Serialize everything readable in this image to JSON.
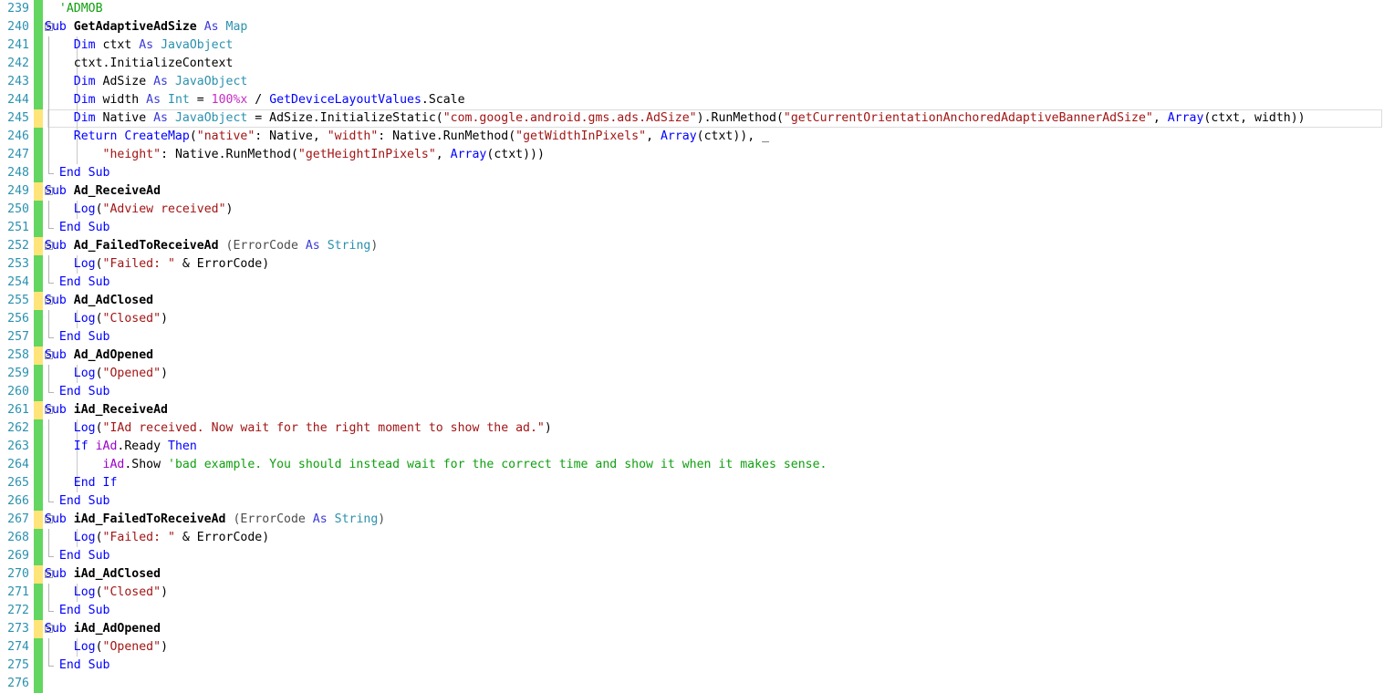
{
  "editor": {
    "app": "B4A Code Editor",
    "language": "Basic4Android",
    "first_visible_line": 239,
    "last_visible_line": 276,
    "current_line": 245,
    "colors": {
      "background": "#ffffff",
      "line_number": "#2b91af",
      "marker_saved": "#62d660",
      "marker_unsaved": "#ffe47a",
      "keyword": "#0000ff",
      "type": "#2b91af",
      "string": "#a31515",
      "comment": "#10a010",
      "number": "#c52bc5",
      "object": "#9b00c8"
    },
    "lines": [
      {
        "n": "239",
        "marker": "green",
        "fold": false,
        "indent": 0,
        "tokens": [
          {
            "t": "  ",
            "c": "punct"
          },
          {
            "t": "'ADMOB",
            "c": "cmt"
          }
        ]
      },
      {
        "n": "240",
        "marker": "green",
        "fold": true,
        "foldstart": true,
        "indent": 0,
        "tokens": [
          {
            "t": "Sub ",
            "c": "kw"
          },
          {
            "t": "GetAdaptiveAdSize",
            "c": "subname"
          },
          {
            "t": " ",
            "c": "punct"
          },
          {
            "t": "As ",
            "c": "as"
          },
          {
            "t": "Map",
            "c": "type"
          }
        ]
      },
      {
        "n": "241",
        "marker": "green",
        "fold": false,
        "indent": 1,
        "tokens": [
          {
            "t": "    ",
            "c": "punct"
          },
          {
            "t": "Dim ",
            "c": "kw"
          },
          {
            "t": "ctxt ",
            "c": "id"
          },
          {
            "t": "As ",
            "c": "as"
          },
          {
            "t": "JavaObject",
            "c": "type"
          }
        ]
      },
      {
        "n": "242",
        "marker": "green",
        "fold": false,
        "indent": 1,
        "tokens": [
          {
            "t": "    ",
            "c": "punct"
          },
          {
            "t": "ctxt.InitializeContext",
            "c": "id"
          }
        ]
      },
      {
        "n": "243",
        "marker": "green",
        "fold": false,
        "indent": 1,
        "tokens": [
          {
            "t": "    ",
            "c": "punct"
          },
          {
            "t": "Dim ",
            "c": "kw"
          },
          {
            "t": "AdSize ",
            "c": "id"
          },
          {
            "t": "As ",
            "c": "as"
          },
          {
            "t": "JavaObject",
            "c": "type"
          }
        ]
      },
      {
        "n": "244",
        "marker": "green",
        "fold": false,
        "indent": 1,
        "tokens": [
          {
            "t": "    ",
            "c": "punct"
          },
          {
            "t": "Dim ",
            "c": "kw"
          },
          {
            "t": "width ",
            "c": "id"
          },
          {
            "t": "As ",
            "c": "as"
          },
          {
            "t": "Int ",
            "c": "type"
          },
          {
            "t": "= ",
            "c": "punct"
          },
          {
            "t": "100%x",
            "c": "num"
          },
          {
            "t": " / ",
            "c": "punct"
          },
          {
            "t": "GetDeviceLayoutValues",
            "c": "fn"
          },
          {
            "t": ".Scale",
            "c": "id"
          }
        ]
      },
      {
        "n": "245",
        "marker": "yellow",
        "fold": false,
        "current": true,
        "indent": 1,
        "tokens": [
          {
            "t": "    ",
            "c": "punct"
          },
          {
            "t": "Dim ",
            "c": "kw"
          },
          {
            "t": "Native ",
            "c": "id"
          },
          {
            "t": "As ",
            "c": "as"
          },
          {
            "t": "JavaObject ",
            "c": "type"
          },
          {
            "t": "= ",
            "c": "punct"
          },
          {
            "t": "AdSize.InitializeStatic(",
            "c": "id"
          },
          {
            "t": "\"com.google.android.gms.ads.AdSize\"",
            "c": "str"
          },
          {
            "t": ").RunMethod(",
            "c": "id"
          },
          {
            "t": "\"getCurrentOrientationAnchoredAdaptiveBannerAdSize\"",
            "c": "str"
          },
          {
            "t": ", ",
            "c": "punct"
          },
          {
            "t": "Array",
            "c": "fn"
          },
          {
            "t": "(ctxt, width))",
            "c": "id"
          }
        ]
      },
      {
        "n": "246",
        "marker": "green",
        "fold": false,
        "indent": 1,
        "tokens": [
          {
            "t": "    ",
            "c": "punct"
          },
          {
            "t": "Return ",
            "c": "kw"
          },
          {
            "t": "CreateMap",
            "c": "fn"
          },
          {
            "t": "(",
            "c": "id"
          },
          {
            "t": "\"native\"",
            "c": "str"
          },
          {
            "t": ": Native, ",
            "c": "id"
          },
          {
            "t": "\"width\"",
            "c": "str"
          },
          {
            "t": ": Native.RunMethod(",
            "c": "id"
          },
          {
            "t": "\"getWidthInPixels\"",
            "c": "str"
          },
          {
            "t": ", ",
            "c": "punct"
          },
          {
            "t": "Array",
            "c": "fn"
          },
          {
            "t": "(ctxt)), _",
            "c": "id"
          }
        ]
      },
      {
        "n": "247",
        "marker": "green",
        "fold": false,
        "indent": 1,
        "tokens": [
          {
            "t": "        ",
            "c": "punct"
          },
          {
            "t": "\"height\"",
            "c": "str"
          },
          {
            "t": ": Native.RunMethod(",
            "c": "id"
          },
          {
            "t": "\"getHeightInPixels\"",
            "c": "str"
          },
          {
            "t": ", ",
            "c": "punct"
          },
          {
            "t": "Array",
            "c": "fn"
          },
          {
            "t": "(ctxt)))",
            "c": "id"
          }
        ]
      },
      {
        "n": "248",
        "marker": "green",
        "fold": false,
        "foldend": true,
        "indent": 0,
        "tokens": [
          {
            "t": "  ",
            "c": "punct"
          },
          {
            "t": "End Sub",
            "c": "kw"
          }
        ]
      },
      {
        "n": "249",
        "marker": "yellow",
        "fold": true,
        "foldstart": true,
        "indent": 0,
        "tokens": [
          {
            "t": "Sub ",
            "c": "kw"
          },
          {
            "t": "Ad_ReceiveAd",
            "c": "subname"
          }
        ]
      },
      {
        "n": "250",
        "marker": "green",
        "fold": false,
        "indent": 1,
        "tokens": [
          {
            "t": "    ",
            "c": "punct"
          },
          {
            "t": "Log",
            "c": "fn"
          },
          {
            "t": "(",
            "c": "id"
          },
          {
            "t": "\"Adview received\"",
            "c": "str"
          },
          {
            "t": ")",
            "c": "id"
          }
        ]
      },
      {
        "n": "251",
        "marker": "green",
        "fold": false,
        "foldend": true,
        "indent": 0,
        "tokens": [
          {
            "t": "  ",
            "c": "punct"
          },
          {
            "t": "End Sub",
            "c": "kw"
          }
        ]
      },
      {
        "n": "252",
        "marker": "yellow",
        "fold": true,
        "foldstart": true,
        "indent": 0,
        "tokens": [
          {
            "t": "Sub ",
            "c": "kw"
          },
          {
            "t": "Ad_FailedToReceiveAd",
            "c": "subname"
          },
          {
            "t": " (",
            "c": "param"
          },
          {
            "t": "ErrorCode ",
            "c": "param"
          },
          {
            "t": "As ",
            "c": "as"
          },
          {
            "t": "String",
            "c": "type"
          },
          {
            "t": ")",
            "c": "param"
          }
        ]
      },
      {
        "n": "253",
        "marker": "green",
        "fold": false,
        "indent": 1,
        "tokens": [
          {
            "t": "    ",
            "c": "punct"
          },
          {
            "t": "Log",
            "c": "fn"
          },
          {
            "t": "(",
            "c": "id"
          },
          {
            "t": "\"Failed: \"",
            "c": "str"
          },
          {
            "t": " & ErrorCode)",
            "c": "id"
          }
        ]
      },
      {
        "n": "254",
        "marker": "green",
        "fold": false,
        "foldend": true,
        "indent": 0,
        "tokens": [
          {
            "t": "  ",
            "c": "punct"
          },
          {
            "t": "End Sub",
            "c": "kw"
          }
        ]
      },
      {
        "n": "255",
        "marker": "yellow",
        "fold": true,
        "foldstart": true,
        "indent": 0,
        "tokens": [
          {
            "t": "Sub ",
            "c": "kw"
          },
          {
            "t": "Ad_AdClosed",
            "c": "subname"
          }
        ]
      },
      {
        "n": "256",
        "marker": "green",
        "fold": false,
        "indent": 1,
        "tokens": [
          {
            "t": "    ",
            "c": "punct"
          },
          {
            "t": "Log",
            "c": "fn"
          },
          {
            "t": "(",
            "c": "id"
          },
          {
            "t": "\"Closed\"",
            "c": "str"
          },
          {
            "t": ")",
            "c": "id"
          }
        ]
      },
      {
        "n": "257",
        "marker": "green",
        "fold": false,
        "foldend": true,
        "indent": 0,
        "tokens": [
          {
            "t": "  ",
            "c": "punct"
          },
          {
            "t": "End Sub",
            "c": "kw"
          }
        ]
      },
      {
        "n": "258",
        "marker": "yellow",
        "fold": true,
        "foldstart": true,
        "indent": 0,
        "tokens": [
          {
            "t": "Sub ",
            "c": "kw"
          },
          {
            "t": "Ad_AdOpened",
            "c": "subname"
          }
        ]
      },
      {
        "n": "259",
        "marker": "green",
        "fold": false,
        "indent": 1,
        "tokens": [
          {
            "t": "    ",
            "c": "punct"
          },
          {
            "t": "Log",
            "c": "fn"
          },
          {
            "t": "(",
            "c": "id"
          },
          {
            "t": "\"Opened\"",
            "c": "str"
          },
          {
            "t": ")",
            "c": "id"
          }
        ]
      },
      {
        "n": "260",
        "marker": "green",
        "fold": false,
        "foldend": true,
        "indent": 0,
        "tokens": [
          {
            "t": "  ",
            "c": "punct"
          },
          {
            "t": "End Sub",
            "c": "kw"
          }
        ]
      },
      {
        "n": "261",
        "marker": "yellow",
        "fold": true,
        "foldstart": true,
        "indent": 0,
        "tokens": [
          {
            "t": "Sub ",
            "c": "kw"
          },
          {
            "t": "iAd_ReceiveAd",
            "c": "subname"
          }
        ]
      },
      {
        "n": "262",
        "marker": "green",
        "fold": false,
        "indent": 1,
        "tokens": [
          {
            "t": "    ",
            "c": "punct"
          },
          {
            "t": "Log",
            "c": "fn"
          },
          {
            "t": "(",
            "c": "id"
          },
          {
            "t": "\"IAd received. Now wait for the right moment to show the ad.\"",
            "c": "str"
          },
          {
            "t": ")",
            "c": "id"
          }
        ]
      },
      {
        "n": "263",
        "marker": "green",
        "fold": false,
        "indent": 1,
        "tokens": [
          {
            "t": "    ",
            "c": "punct"
          },
          {
            "t": "If ",
            "c": "kw"
          },
          {
            "t": "iAd",
            "c": "obj"
          },
          {
            "t": ".Ready ",
            "c": "id"
          },
          {
            "t": "Then",
            "c": "kw"
          }
        ]
      },
      {
        "n": "264",
        "marker": "green",
        "fold": false,
        "indent": 2,
        "tokens": [
          {
            "t": "        ",
            "c": "punct"
          },
          {
            "t": "iAd",
            "c": "obj"
          },
          {
            "t": ".Show ",
            "c": "id"
          },
          {
            "t": "'bad example. You should instead wait for the correct time and show it when it makes sense.",
            "c": "cmt"
          }
        ]
      },
      {
        "n": "265",
        "marker": "green",
        "fold": false,
        "indent": 1,
        "tokens": [
          {
            "t": "    ",
            "c": "punct"
          },
          {
            "t": "End If",
            "c": "kw"
          }
        ]
      },
      {
        "n": "266",
        "marker": "green",
        "fold": false,
        "foldend": true,
        "indent": 0,
        "tokens": [
          {
            "t": "  ",
            "c": "punct"
          },
          {
            "t": "End Sub",
            "c": "kw"
          }
        ]
      },
      {
        "n": "267",
        "marker": "yellow",
        "fold": true,
        "foldstart": true,
        "indent": 0,
        "tokens": [
          {
            "t": "Sub ",
            "c": "kw"
          },
          {
            "t": "iAd_FailedToReceiveAd",
            "c": "subname"
          },
          {
            "t": " (",
            "c": "param"
          },
          {
            "t": "ErrorCode ",
            "c": "param"
          },
          {
            "t": "As ",
            "c": "as"
          },
          {
            "t": "String",
            "c": "type"
          },
          {
            "t": ")",
            "c": "param"
          }
        ]
      },
      {
        "n": "268",
        "marker": "green",
        "fold": false,
        "indent": 1,
        "tokens": [
          {
            "t": "    ",
            "c": "punct"
          },
          {
            "t": "Log",
            "c": "fn"
          },
          {
            "t": "(",
            "c": "id"
          },
          {
            "t": "\"Failed: \"",
            "c": "str"
          },
          {
            "t": " & ErrorCode)",
            "c": "id"
          }
        ]
      },
      {
        "n": "269",
        "marker": "green",
        "fold": false,
        "foldend": true,
        "indent": 0,
        "tokens": [
          {
            "t": "  ",
            "c": "punct"
          },
          {
            "t": "End Sub",
            "c": "kw"
          }
        ]
      },
      {
        "n": "270",
        "marker": "yellow",
        "fold": true,
        "foldstart": true,
        "indent": 0,
        "tokens": [
          {
            "t": "Sub ",
            "c": "kw"
          },
          {
            "t": "iAd_AdClosed",
            "c": "subname"
          }
        ]
      },
      {
        "n": "271",
        "marker": "green",
        "fold": false,
        "indent": 1,
        "tokens": [
          {
            "t": "    ",
            "c": "punct"
          },
          {
            "t": "Log",
            "c": "fn"
          },
          {
            "t": "(",
            "c": "id"
          },
          {
            "t": "\"Closed\"",
            "c": "str"
          },
          {
            "t": ")",
            "c": "id"
          }
        ]
      },
      {
        "n": "272",
        "marker": "green",
        "fold": false,
        "foldend": true,
        "indent": 0,
        "tokens": [
          {
            "t": "  ",
            "c": "punct"
          },
          {
            "t": "End Sub",
            "c": "kw"
          }
        ]
      },
      {
        "n": "273",
        "marker": "yellow",
        "fold": true,
        "foldstart": true,
        "indent": 0,
        "tokens": [
          {
            "t": "Sub ",
            "c": "kw"
          },
          {
            "t": "iAd_AdOpened",
            "c": "subname"
          }
        ]
      },
      {
        "n": "274",
        "marker": "green",
        "fold": false,
        "indent": 1,
        "tokens": [
          {
            "t": "    ",
            "c": "punct"
          },
          {
            "t": "Log",
            "c": "fn"
          },
          {
            "t": "(",
            "c": "id"
          },
          {
            "t": "\"Opened\"",
            "c": "str"
          },
          {
            "t": ")",
            "c": "id"
          }
        ]
      },
      {
        "n": "275",
        "marker": "green",
        "fold": false,
        "foldend": true,
        "indent": 0,
        "tokens": [
          {
            "t": "  ",
            "c": "punct"
          },
          {
            "t": "End Sub",
            "c": "kw"
          }
        ]
      },
      {
        "n": "276",
        "marker": "green",
        "fold": false,
        "clipped": true,
        "indent": 0,
        "tokens": []
      }
    ]
  }
}
